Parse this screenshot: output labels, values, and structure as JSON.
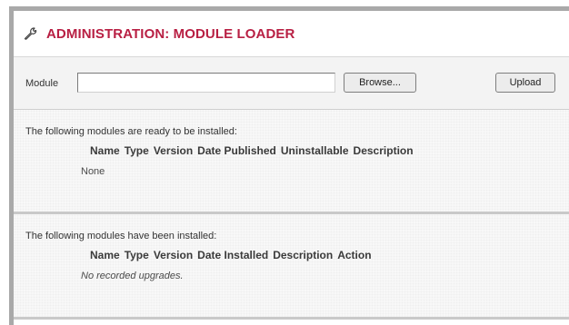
{
  "header": {
    "title": "ADMINISTRATION: MODULE LOADER",
    "icon": "wrench-icon"
  },
  "upload": {
    "module_label": "Module",
    "file_value": "",
    "browse_label": "Browse...",
    "upload_label": "Upload"
  },
  "pending": {
    "intro": "The following modules are ready to be installed:",
    "columns": [
      "Name",
      "Type",
      "Version",
      "Date Published",
      "Uninstallable",
      "Description"
    ],
    "empty_text": "None"
  },
  "installed": {
    "intro": "The following modules have been installed:",
    "columns": [
      "Name",
      "Type",
      "Version",
      "Date Installed",
      "Description",
      "Action"
    ],
    "empty_text": "No recorded upgrades."
  },
  "colors": {
    "title": "#b81f43",
    "frame_border": "#a9a9a9",
    "bar_background": "#f3f3f3"
  }
}
